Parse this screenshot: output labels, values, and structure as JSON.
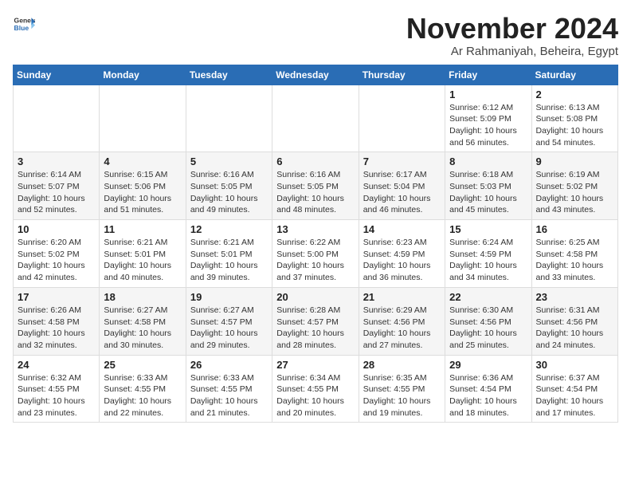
{
  "header": {
    "logo_general": "General",
    "logo_blue": "Blue",
    "month_title": "November 2024",
    "location": "Ar Rahmaniyah, Beheira, Egypt"
  },
  "weekdays": [
    "Sunday",
    "Monday",
    "Tuesday",
    "Wednesday",
    "Thursday",
    "Friday",
    "Saturday"
  ],
  "weeks": [
    [
      {
        "day": "",
        "info": ""
      },
      {
        "day": "",
        "info": ""
      },
      {
        "day": "",
        "info": ""
      },
      {
        "day": "",
        "info": ""
      },
      {
        "day": "",
        "info": ""
      },
      {
        "day": "1",
        "info": "Sunrise: 6:12 AM\nSunset: 5:09 PM\nDaylight: 10 hours and 56 minutes."
      },
      {
        "day": "2",
        "info": "Sunrise: 6:13 AM\nSunset: 5:08 PM\nDaylight: 10 hours and 54 minutes."
      }
    ],
    [
      {
        "day": "3",
        "info": "Sunrise: 6:14 AM\nSunset: 5:07 PM\nDaylight: 10 hours and 52 minutes."
      },
      {
        "day": "4",
        "info": "Sunrise: 6:15 AM\nSunset: 5:06 PM\nDaylight: 10 hours and 51 minutes."
      },
      {
        "day": "5",
        "info": "Sunrise: 6:16 AM\nSunset: 5:05 PM\nDaylight: 10 hours and 49 minutes."
      },
      {
        "day": "6",
        "info": "Sunrise: 6:16 AM\nSunset: 5:05 PM\nDaylight: 10 hours and 48 minutes."
      },
      {
        "day": "7",
        "info": "Sunrise: 6:17 AM\nSunset: 5:04 PM\nDaylight: 10 hours and 46 minutes."
      },
      {
        "day": "8",
        "info": "Sunrise: 6:18 AM\nSunset: 5:03 PM\nDaylight: 10 hours and 45 minutes."
      },
      {
        "day": "9",
        "info": "Sunrise: 6:19 AM\nSunset: 5:02 PM\nDaylight: 10 hours and 43 minutes."
      }
    ],
    [
      {
        "day": "10",
        "info": "Sunrise: 6:20 AM\nSunset: 5:02 PM\nDaylight: 10 hours and 42 minutes."
      },
      {
        "day": "11",
        "info": "Sunrise: 6:21 AM\nSunset: 5:01 PM\nDaylight: 10 hours and 40 minutes."
      },
      {
        "day": "12",
        "info": "Sunrise: 6:21 AM\nSunset: 5:01 PM\nDaylight: 10 hours and 39 minutes."
      },
      {
        "day": "13",
        "info": "Sunrise: 6:22 AM\nSunset: 5:00 PM\nDaylight: 10 hours and 37 minutes."
      },
      {
        "day": "14",
        "info": "Sunrise: 6:23 AM\nSunset: 4:59 PM\nDaylight: 10 hours and 36 minutes."
      },
      {
        "day": "15",
        "info": "Sunrise: 6:24 AM\nSunset: 4:59 PM\nDaylight: 10 hours and 34 minutes."
      },
      {
        "day": "16",
        "info": "Sunrise: 6:25 AM\nSunset: 4:58 PM\nDaylight: 10 hours and 33 minutes."
      }
    ],
    [
      {
        "day": "17",
        "info": "Sunrise: 6:26 AM\nSunset: 4:58 PM\nDaylight: 10 hours and 32 minutes."
      },
      {
        "day": "18",
        "info": "Sunrise: 6:27 AM\nSunset: 4:58 PM\nDaylight: 10 hours and 30 minutes."
      },
      {
        "day": "19",
        "info": "Sunrise: 6:27 AM\nSunset: 4:57 PM\nDaylight: 10 hours and 29 minutes."
      },
      {
        "day": "20",
        "info": "Sunrise: 6:28 AM\nSunset: 4:57 PM\nDaylight: 10 hours and 28 minutes."
      },
      {
        "day": "21",
        "info": "Sunrise: 6:29 AM\nSunset: 4:56 PM\nDaylight: 10 hours and 27 minutes."
      },
      {
        "day": "22",
        "info": "Sunrise: 6:30 AM\nSunset: 4:56 PM\nDaylight: 10 hours and 25 minutes."
      },
      {
        "day": "23",
        "info": "Sunrise: 6:31 AM\nSunset: 4:56 PM\nDaylight: 10 hours and 24 minutes."
      }
    ],
    [
      {
        "day": "24",
        "info": "Sunrise: 6:32 AM\nSunset: 4:55 PM\nDaylight: 10 hours and 23 minutes."
      },
      {
        "day": "25",
        "info": "Sunrise: 6:33 AM\nSunset: 4:55 PM\nDaylight: 10 hours and 22 minutes."
      },
      {
        "day": "26",
        "info": "Sunrise: 6:33 AM\nSunset: 4:55 PM\nDaylight: 10 hours and 21 minutes."
      },
      {
        "day": "27",
        "info": "Sunrise: 6:34 AM\nSunset: 4:55 PM\nDaylight: 10 hours and 20 minutes."
      },
      {
        "day": "28",
        "info": "Sunrise: 6:35 AM\nSunset: 4:55 PM\nDaylight: 10 hours and 19 minutes."
      },
      {
        "day": "29",
        "info": "Sunrise: 6:36 AM\nSunset: 4:54 PM\nDaylight: 10 hours and 18 minutes."
      },
      {
        "day": "30",
        "info": "Sunrise: 6:37 AM\nSunset: 4:54 PM\nDaylight: 10 hours and 17 minutes."
      }
    ]
  ]
}
